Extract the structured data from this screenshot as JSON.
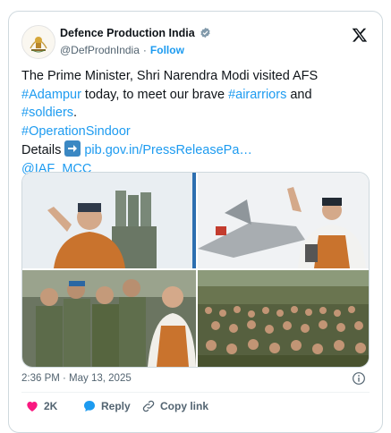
{
  "author": {
    "name": "Defence Production India",
    "handle": "@DefProdnIndia",
    "separator": "·",
    "follow_label": "Follow"
  },
  "tweet": {
    "line1": "The Prime Minister, Shri Narendra Modi visited AFS",
    "hashtag_adampur": "#Adampur",
    "mid_text": " today, to meet our brave ",
    "hashtag_airwarriors": "#airarriors",
    "and_text": " and",
    "hashtag_soldiers": "#soldiers",
    "period": ".",
    "hashtag_operation": "#OperationSindoor",
    "details_label": "Details ",
    "details_link": "pib.gov.in/PressReleasePa…",
    "mention": "@IAF_MCC"
  },
  "timestamp": "2:36 PM · May 13, 2025",
  "actions": {
    "likes": "2K",
    "reply": "Reply",
    "copy_link": "Copy link"
  },
  "colors": {
    "accent": "#1d9bf0",
    "like": "#f91880",
    "text": "#0f1419",
    "muted": "#536471"
  },
  "icons": [
    "x-logo-icon",
    "verified-badge-icon",
    "right-arrow-icon",
    "info-icon",
    "heart-icon",
    "reply-icon",
    "link-icon"
  ]
}
